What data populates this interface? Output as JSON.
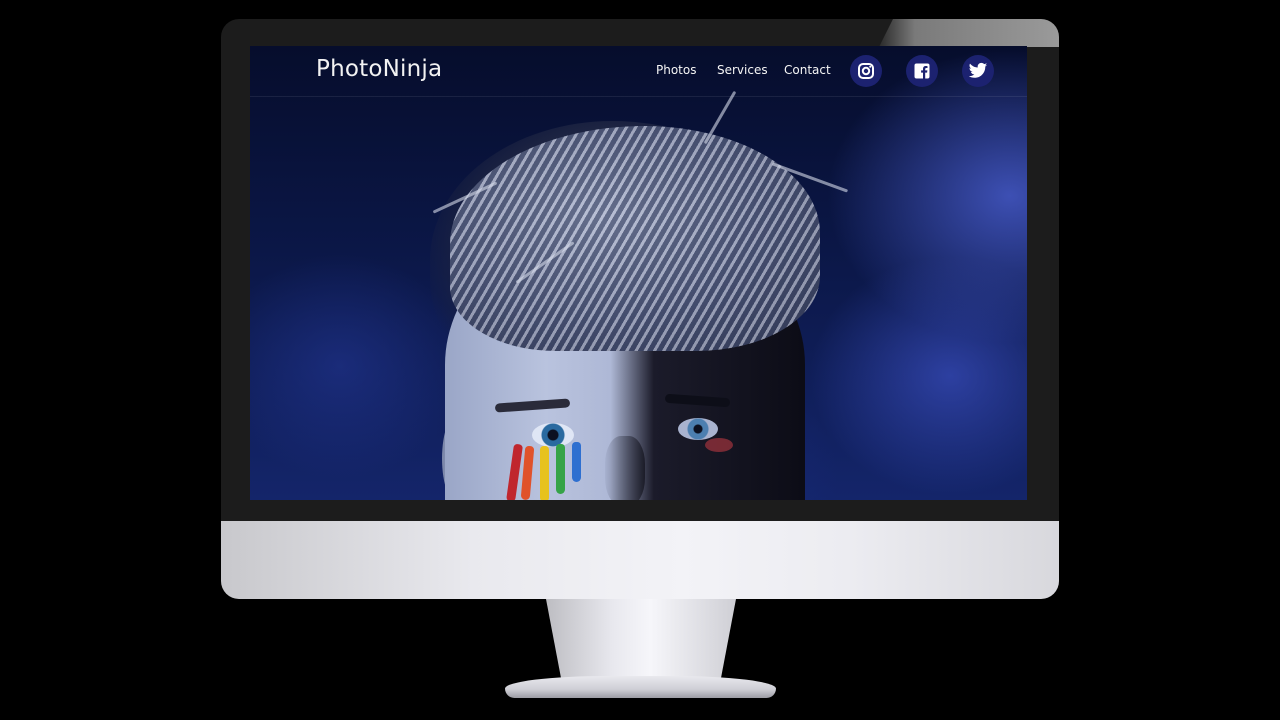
{
  "site": {
    "brand": "PhotoNinja",
    "nav": {
      "photos": "Photos",
      "services": "Services",
      "contact": "Contact"
    },
    "social": [
      {
        "icon": "instagram-icon"
      },
      {
        "icon": "facebook-icon"
      },
      {
        "icon": "twitter-icon"
      }
    ]
  },
  "colors": {
    "social_bg": "#1c2270",
    "nav_text": "#f5f5f5",
    "hero_blue": "#0b1747"
  }
}
